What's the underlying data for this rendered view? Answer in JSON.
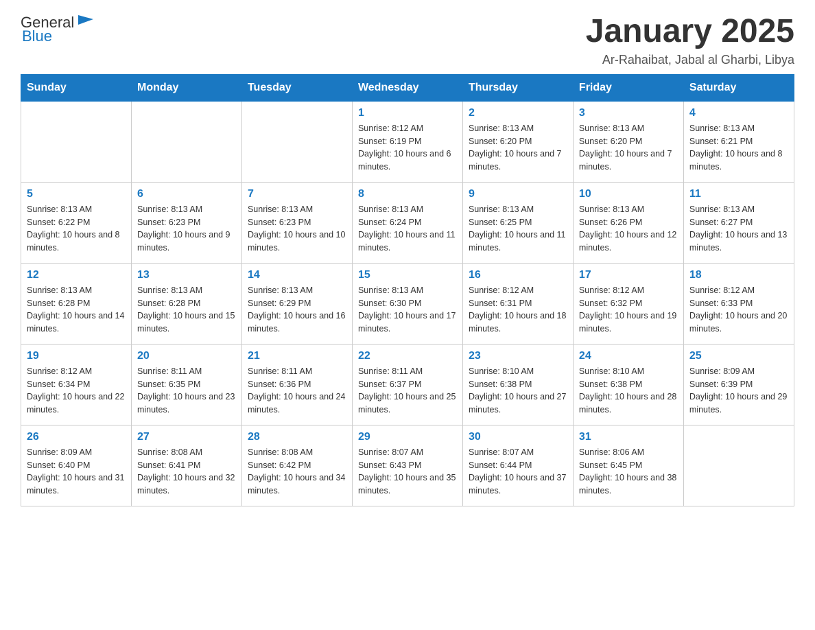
{
  "logo": {
    "text_general": "General",
    "text_blue": "Blue",
    "alt": "GeneralBlue logo"
  },
  "title": "January 2025",
  "location": "Ar-Rahaibat, Jabal al Gharbi, Libya",
  "days_of_week": [
    "Sunday",
    "Monday",
    "Tuesday",
    "Wednesday",
    "Thursday",
    "Friday",
    "Saturday"
  ],
  "weeks": [
    [
      {
        "day": "",
        "info": ""
      },
      {
        "day": "",
        "info": ""
      },
      {
        "day": "",
        "info": ""
      },
      {
        "day": "1",
        "info": "Sunrise: 8:12 AM\nSunset: 6:19 PM\nDaylight: 10 hours and 6 minutes."
      },
      {
        "day": "2",
        "info": "Sunrise: 8:13 AM\nSunset: 6:20 PM\nDaylight: 10 hours and 7 minutes."
      },
      {
        "day": "3",
        "info": "Sunrise: 8:13 AM\nSunset: 6:20 PM\nDaylight: 10 hours and 7 minutes."
      },
      {
        "day": "4",
        "info": "Sunrise: 8:13 AM\nSunset: 6:21 PM\nDaylight: 10 hours and 8 minutes."
      }
    ],
    [
      {
        "day": "5",
        "info": "Sunrise: 8:13 AM\nSunset: 6:22 PM\nDaylight: 10 hours and 8 minutes."
      },
      {
        "day": "6",
        "info": "Sunrise: 8:13 AM\nSunset: 6:23 PM\nDaylight: 10 hours and 9 minutes."
      },
      {
        "day": "7",
        "info": "Sunrise: 8:13 AM\nSunset: 6:23 PM\nDaylight: 10 hours and 10 minutes."
      },
      {
        "day": "8",
        "info": "Sunrise: 8:13 AM\nSunset: 6:24 PM\nDaylight: 10 hours and 11 minutes."
      },
      {
        "day": "9",
        "info": "Sunrise: 8:13 AM\nSunset: 6:25 PM\nDaylight: 10 hours and 11 minutes."
      },
      {
        "day": "10",
        "info": "Sunrise: 8:13 AM\nSunset: 6:26 PM\nDaylight: 10 hours and 12 minutes."
      },
      {
        "day": "11",
        "info": "Sunrise: 8:13 AM\nSunset: 6:27 PM\nDaylight: 10 hours and 13 minutes."
      }
    ],
    [
      {
        "day": "12",
        "info": "Sunrise: 8:13 AM\nSunset: 6:28 PM\nDaylight: 10 hours and 14 minutes."
      },
      {
        "day": "13",
        "info": "Sunrise: 8:13 AM\nSunset: 6:28 PM\nDaylight: 10 hours and 15 minutes."
      },
      {
        "day": "14",
        "info": "Sunrise: 8:13 AM\nSunset: 6:29 PM\nDaylight: 10 hours and 16 minutes."
      },
      {
        "day": "15",
        "info": "Sunrise: 8:13 AM\nSunset: 6:30 PM\nDaylight: 10 hours and 17 minutes."
      },
      {
        "day": "16",
        "info": "Sunrise: 8:12 AM\nSunset: 6:31 PM\nDaylight: 10 hours and 18 minutes."
      },
      {
        "day": "17",
        "info": "Sunrise: 8:12 AM\nSunset: 6:32 PM\nDaylight: 10 hours and 19 minutes."
      },
      {
        "day": "18",
        "info": "Sunrise: 8:12 AM\nSunset: 6:33 PM\nDaylight: 10 hours and 20 minutes."
      }
    ],
    [
      {
        "day": "19",
        "info": "Sunrise: 8:12 AM\nSunset: 6:34 PM\nDaylight: 10 hours and 22 minutes."
      },
      {
        "day": "20",
        "info": "Sunrise: 8:11 AM\nSunset: 6:35 PM\nDaylight: 10 hours and 23 minutes."
      },
      {
        "day": "21",
        "info": "Sunrise: 8:11 AM\nSunset: 6:36 PM\nDaylight: 10 hours and 24 minutes."
      },
      {
        "day": "22",
        "info": "Sunrise: 8:11 AM\nSunset: 6:37 PM\nDaylight: 10 hours and 25 minutes."
      },
      {
        "day": "23",
        "info": "Sunrise: 8:10 AM\nSunset: 6:38 PM\nDaylight: 10 hours and 27 minutes."
      },
      {
        "day": "24",
        "info": "Sunrise: 8:10 AM\nSunset: 6:38 PM\nDaylight: 10 hours and 28 minutes."
      },
      {
        "day": "25",
        "info": "Sunrise: 8:09 AM\nSunset: 6:39 PM\nDaylight: 10 hours and 29 minutes."
      }
    ],
    [
      {
        "day": "26",
        "info": "Sunrise: 8:09 AM\nSunset: 6:40 PM\nDaylight: 10 hours and 31 minutes."
      },
      {
        "day": "27",
        "info": "Sunrise: 8:08 AM\nSunset: 6:41 PM\nDaylight: 10 hours and 32 minutes."
      },
      {
        "day": "28",
        "info": "Sunrise: 8:08 AM\nSunset: 6:42 PM\nDaylight: 10 hours and 34 minutes."
      },
      {
        "day": "29",
        "info": "Sunrise: 8:07 AM\nSunset: 6:43 PM\nDaylight: 10 hours and 35 minutes."
      },
      {
        "day": "30",
        "info": "Sunrise: 8:07 AM\nSunset: 6:44 PM\nDaylight: 10 hours and 37 minutes."
      },
      {
        "day": "31",
        "info": "Sunrise: 8:06 AM\nSunset: 6:45 PM\nDaylight: 10 hours and 38 minutes."
      },
      {
        "day": "",
        "info": ""
      }
    ]
  ]
}
